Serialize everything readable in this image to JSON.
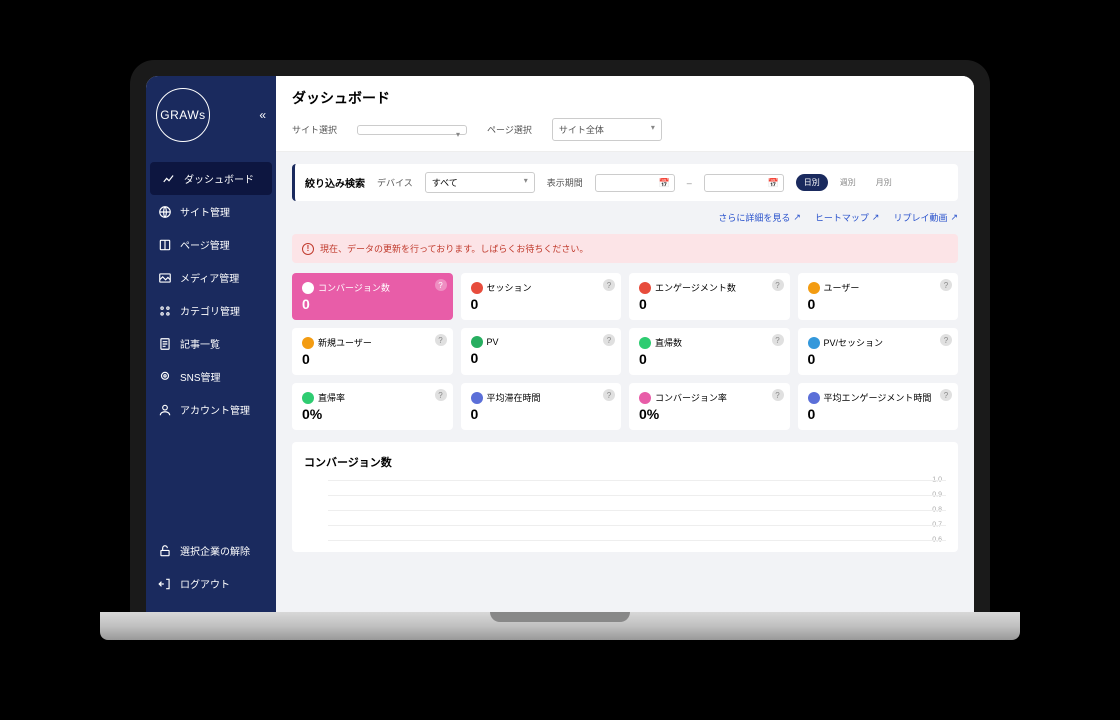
{
  "brand": {
    "name": "GRAWs"
  },
  "sidebar": {
    "items": [
      {
        "label": "ダッシュボード",
        "icon": "chart-line"
      },
      {
        "label": "サイト管理",
        "icon": "globe"
      },
      {
        "label": "ページ管理",
        "icon": "book"
      },
      {
        "label": "メディア管理",
        "icon": "image"
      },
      {
        "label": "カテゴリ管理",
        "icon": "grid"
      },
      {
        "label": "記事一覧",
        "icon": "file"
      },
      {
        "label": "SNS管理",
        "icon": "pin"
      },
      {
        "label": "アカウント管理",
        "icon": "user"
      }
    ],
    "bottom": [
      {
        "label": "選択企業の解除",
        "icon": "unlock"
      },
      {
        "label": "ログアウト",
        "icon": "logout"
      }
    ]
  },
  "header": {
    "title": "ダッシュボード",
    "site_select_label": "サイト選択",
    "site_select_value": "",
    "page_select_label": "ページ選択",
    "page_select_value": "サイト全体"
  },
  "filter": {
    "title": "絞り込み検索",
    "device_label": "デバイス",
    "device_value": "すべて",
    "period_label": "表示期間",
    "date_from": "",
    "date_to": "",
    "date_sep": "–",
    "tabs": {
      "daily": "日別",
      "weekly": "週別",
      "monthly": "月別"
    }
  },
  "links": {
    "more": "さらに詳細を見る",
    "heatmap": "ヒートマップ",
    "replay": "リプレイ動画"
  },
  "alert": {
    "text": "現在、データの更新を行っております。しばらくお待ちください。"
  },
  "metrics": [
    {
      "label": "コンバージョン数",
      "value": "0",
      "color": "#fff",
      "highlight": true
    },
    {
      "label": "セッション",
      "value": "0",
      "color": "#e74c3c"
    },
    {
      "label": "エンゲージメント数",
      "value": "0",
      "color": "#e74c3c"
    },
    {
      "label": "ユーザー",
      "value": "0",
      "color": "#f39c12"
    },
    {
      "label": "新規ユーザー",
      "value": "0",
      "color": "#f39c12"
    },
    {
      "label": "PV",
      "value": "0",
      "color": "#27ae60"
    },
    {
      "label": "直帰数",
      "value": "0",
      "color": "#2ecc71"
    },
    {
      "label": "PV/セッション",
      "value": "0",
      "color": "#3498db"
    },
    {
      "label": "直帰率",
      "value": "0%",
      "color": "#2ecc71"
    },
    {
      "label": "平均滞在時間",
      "value": "0",
      "color": "#5b6fd8"
    },
    {
      "label": "コンバージョン率",
      "value": "0%",
      "color": "#e85da8"
    },
    {
      "label": "平均エンゲージメント時間",
      "value": "0",
      "color": "#5b6fd8"
    }
  ],
  "chart_data": {
    "type": "line",
    "title": "コンバージョン数",
    "xlabel": "",
    "ylabel": "",
    "ylim": [
      0,
      1.0
    ],
    "y_ticks": [
      "1.0",
      "0.9",
      "0.8",
      "0.7",
      "0.6"
    ],
    "categories": [],
    "values": []
  }
}
